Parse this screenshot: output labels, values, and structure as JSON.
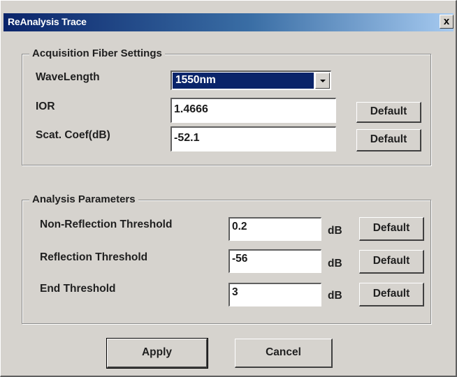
{
  "window": {
    "title": "ReAnalysis Trace",
    "close_label": "x"
  },
  "acquisition": {
    "group_title": "Acquisition Fiber Settings",
    "wavelength_label": "WaveLength",
    "wavelength_value": "1550nm",
    "ior_label": "IOR",
    "ior_value": "1.4666",
    "scat_label": "Scat. Coef(dB)",
    "scat_value": "-52.1",
    "default_label": "Default"
  },
  "analysis": {
    "group_title": "Analysis Parameters",
    "unit": "dB",
    "default_label": "Default",
    "rows": [
      {
        "label": "Non-Reflection Threshold",
        "value": "0.2"
      },
      {
        "label": "Reflection Threshold",
        "value": "-56"
      },
      {
        "label": "End Threshold",
        "value": "3"
      }
    ]
  },
  "footer": {
    "apply_label": "Apply",
    "cancel_label": "Cancel"
  },
  "colors": {
    "titlebar_start": "#0a246a",
    "titlebar_end": "#a6caf0",
    "dialog_face": "#d6d3ce",
    "selection": "#0a246a"
  }
}
